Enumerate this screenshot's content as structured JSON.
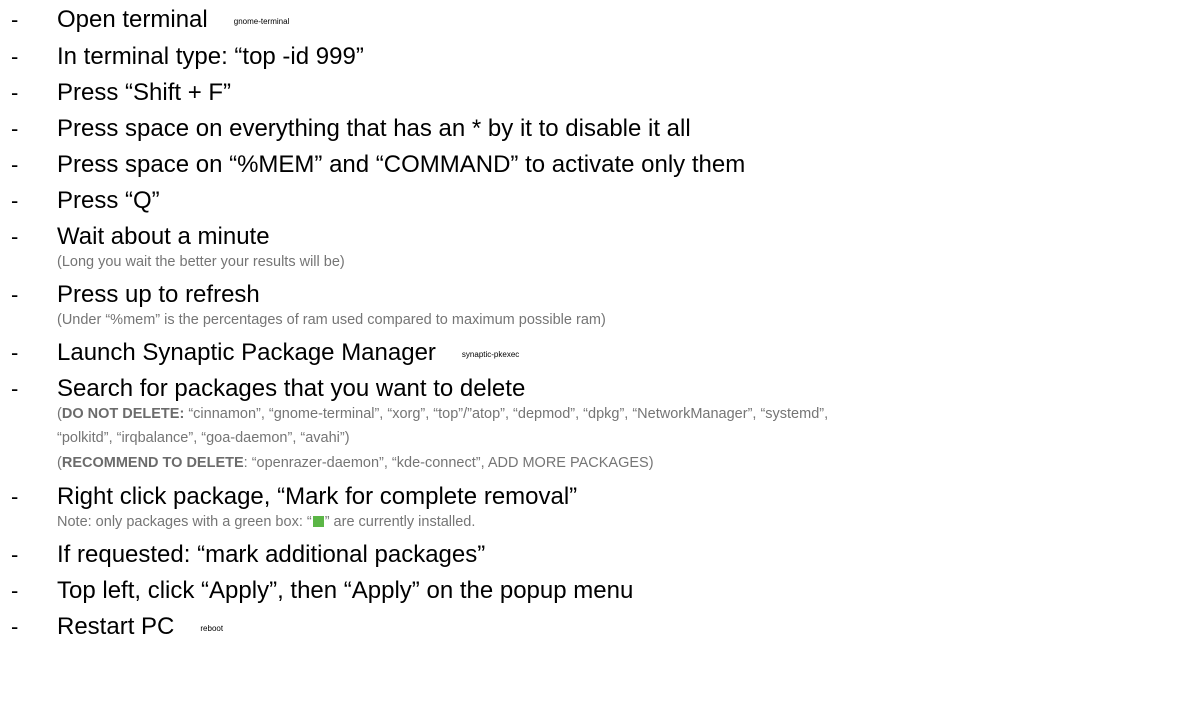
{
  "bullet": "-",
  "steps": [
    {
      "text": "Open terminal",
      "tag": "gnome-terminal"
    },
    {
      "text": "In terminal type: “top -id 999”"
    },
    {
      "text": "Press “Shift + F”"
    },
    {
      "text": "Press space on everything that has an * by it to disable it all"
    },
    {
      "text": "Press space on “%MEM” and “COMMAND” to activate only them"
    },
    {
      "text": "Press “Q”"
    },
    {
      "text": "Wait about a minute",
      "note": "(Long you wait the better your results will be)"
    },
    {
      "text": "Press up to refresh",
      "note": "(Under “%mem” is the percentages of ram used compared to maximum possible ram)"
    },
    {
      "text": "Launch Synaptic Package Manager",
      "tag": "synaptic-pkexec"
    },
    {
      "text": "Search for packages that you want to delete",
      "note_line1_label": "DO NOT DELETE:",
      "note_line1_text": " “cinnamon”, “gnome-terminal”, “xorg”, “top”/”atop”, “depmod”, “dpkg”, “NetworkManager”, “systemd”,",
      "note_line2": "“polkitd”, “irqbalance”, “goa-daemon”, “avahi”)",
      "note_line3_label": "RECOMMEND TO DELETE",
      "note_line3_text": ": “openrazer-daemon”, “kde-connect”, ADD MORE PACKAGES)"
    },
    {
      "text": "Right click package, “Mark for complete removal”",
      "note_before": "Note: only packages with a green box: “",
      "note_after": "” are currently installed."
    },
    {
      "text": "If requested: “mark additional packages”"
    },
    {
      "text": "Top left, click “Apply”, then “Apply” on the popup menu"
    },
    {
      "text": "Restart PC",
      "tag": "reboot"
    }
  ],
  "colors": {
    "note_text": "#757575",
    "green_box": "#5bb646"
  }
}
